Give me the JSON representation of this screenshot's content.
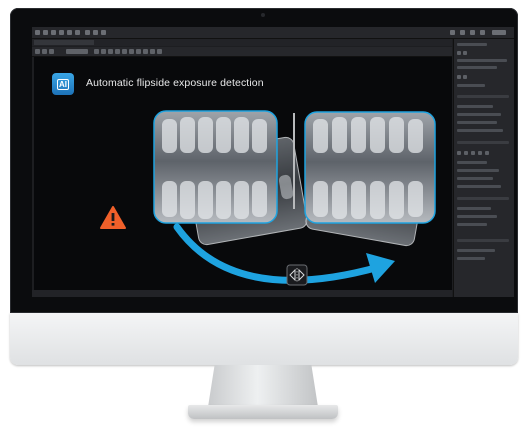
{
  "screen": {
    "headline": "Automatic flipside exposure detection",
    "ai_badge": "AI"
  },
  "icons": {
    "warning": "warning-triangle-icon",
    "mirror": "mirror-flip-icon",
    "arrow": "curved-arrow-icon"
  },
  "colors": {
    "accent": "#1ea3e0",
    "warning": "#f0602a",
    "ai_badge": "#2a8fd6",
    "canvas_bg": "#08090b"
  }
}
